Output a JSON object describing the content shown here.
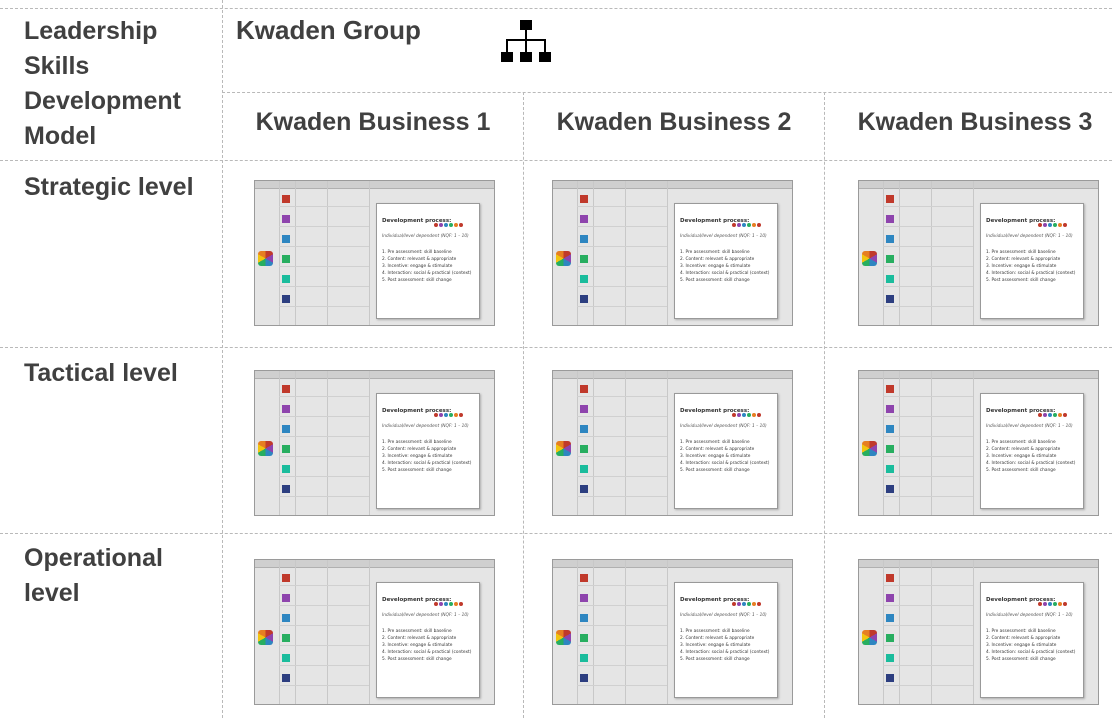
{
  "corner_title": "Leadership Skills Development Model",
  "group": {
    "title": "Kwaden Group",
    "icon": "org-chart-icon"
  },
  "businesses": [
    "Kwaden Business 1",
    "Kwaden Business 2",
    "Kwaden Business 3"
  ],
  "levels": [
    "Strategic level",
    "Tactical level",
    "Operational level"
  ],
  "thumbnail": {
    "title": "Development process:",
    "subtitle": "Individual/level dependent (NQF: 1 – 10)",
    "steps": [
      "1.  Pre assessment: skill baseline",
      "2.  Content: relevant & appropriate",
      "3.  Incentive: engage & stimulate",
      "4.  Interaction: social & practical (context)",
      "5.  Post assessment: skill change"
    ]
  },
  "colors": {
    "text": "#404040",
    "grid": "#b9b9b9",
    "accent_red": "#c0392b",
    "accent_purple": "#8e44ad",
    "accent_blue": "#2e86c1",
    "accent_green": "#27ae60"
  }
}
